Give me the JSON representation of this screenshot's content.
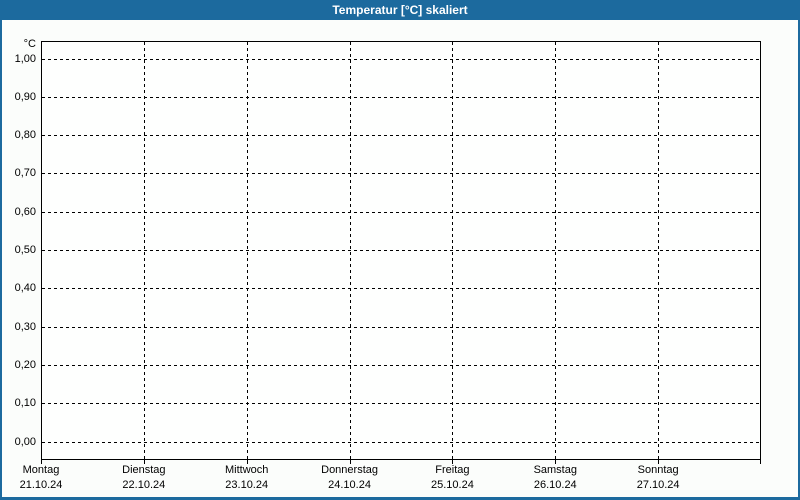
{
  "header": {
    "title": "Temperatur [°C] skaliert"
  },
  "colors": {
    "accent": "#1C6A9E",
    "background": "#FBFDFB",
    "plot_background": "#FEFFFE",
    "grid": "#000000",
    "title_text": "#FFFFFF",
    "label_text": "#000000"
  },
  "chart_data": {
    "type": "line",
    "title": "Temperatur [°C] skaliert",
    "ylabel": "°C",
    "ylim": [
      0.0,
      1.0
    ],
    "y_tick_step": 0.1,
    "y_tick_labels_top_to_bottom": [
      "1,00",
      "0,90",
      "0,80",
      "0,70",
      "0,60",
      "0,50",
      "0,40",
      "0,30",
      "0,20",
      "0,10",
      "0,00"
    ],
    "x_categories": [
      {
        "day": "Montag",
        "date": "21.10.24"
      },
      {
        "day": "Dienstag",
        "date": "22.10.24"
      },
      {
        "day": "Mittwoch",
        "date": "23.10.24"
      },
      {
        "day": "Donnerstag",
        "date": "24.10.24"
      },
      {
        "day": "Freitag",
        "date": "25.10.24"
      },
      {
        "day": "Samstag",
        "date": "26.10.24"
      },
      {
        "day": "Sonntag",
        "date": "27.10.24"
      }
    ],
    "series": [],
    "grid": "dashed",
    "legend": "none"
  }
}
